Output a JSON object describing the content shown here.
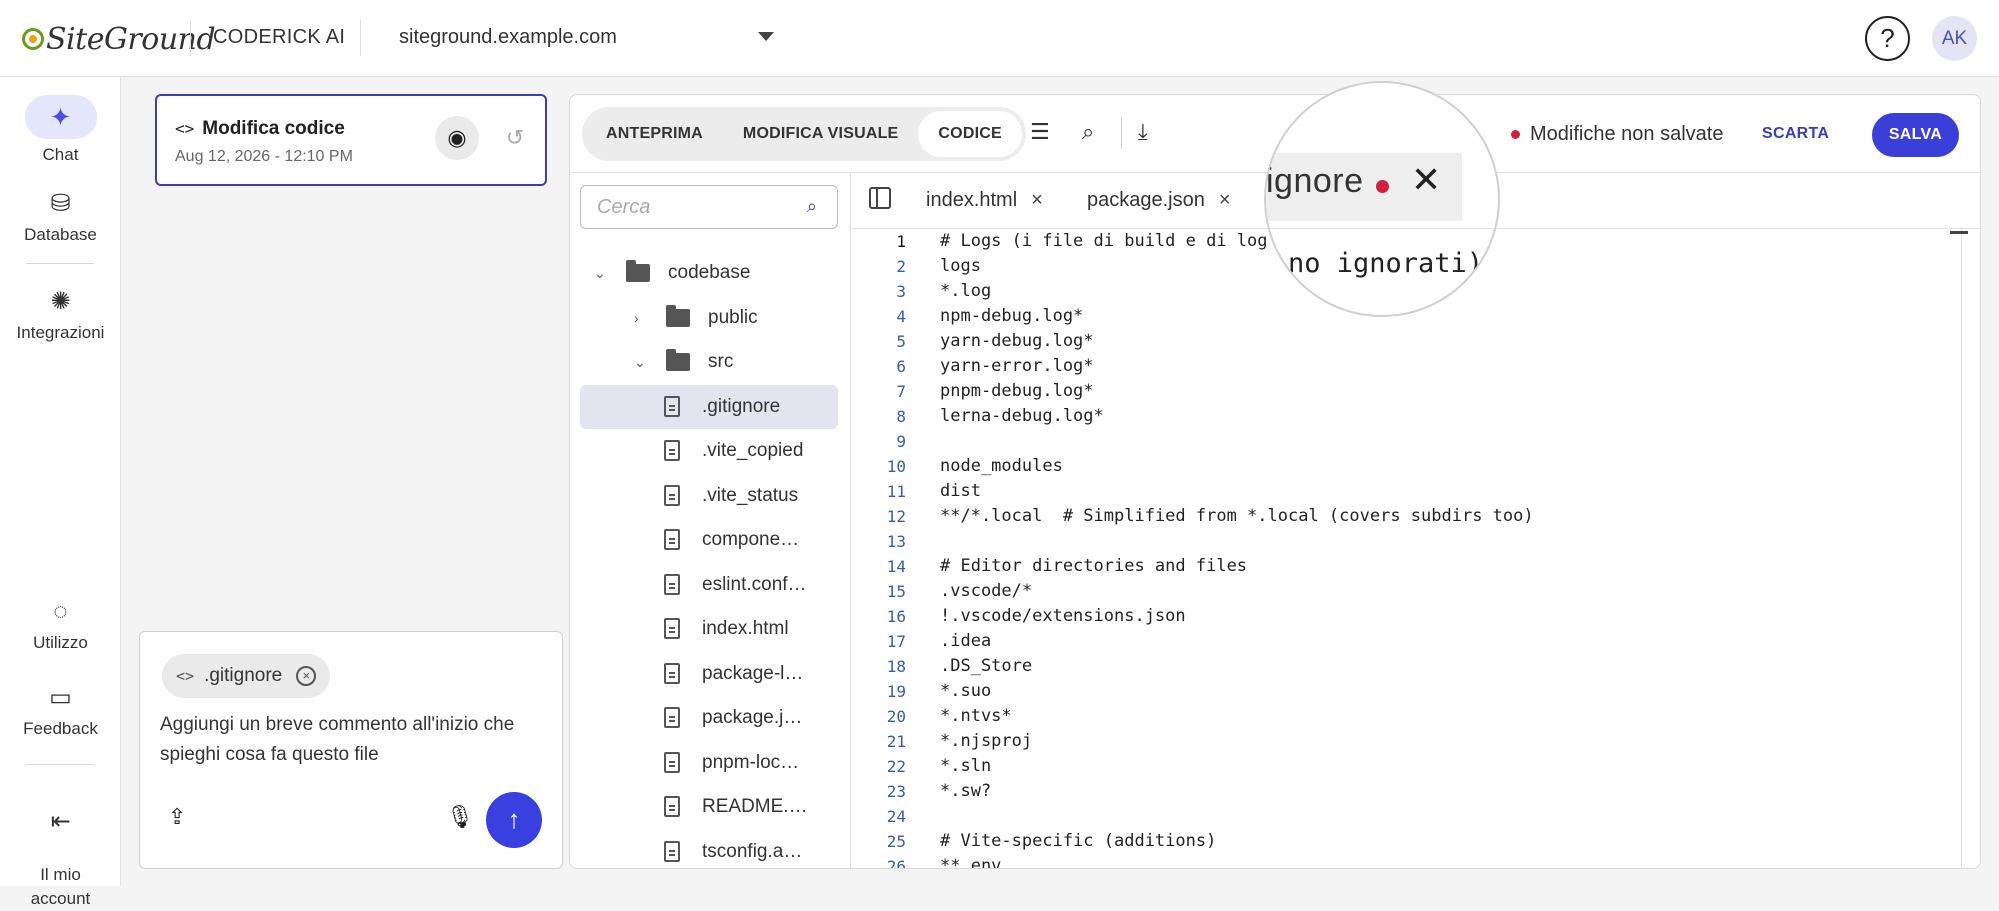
{
  "header": {
    "logo_text": "SiteGround",
    "product_name": "CODERICK AI",
    "domain": "siteground.example.com",
    "help_label": "?",
    "avatar_initials": "AK"
  },
  "sidenav": {
    "items": [
      {
        "label": "Chat",
        "icon": "sparkle-icon"
      },
      {
        "label": "Database",
        "icon": "database-icon"
      },
      {
        "label": "Integrazioni",
        "icon": "integrations-icon"
      },
      {
        "label": "Utilizzo",
        "icon": "usage-icon"
      },
      {
        "label": "Feedback",
        "icon": "feedback-icon"
      },
      {
        "label": "Il mio\naccount",
        "icon": "account-icon"
      }
    ]
  },
  "task": {
    "title": "Modifica codice",
    "date": "Aug 12, 2026 - 12:10 PM"
  },
  "composer": {
    "chip_label": ".gitignore",
    "prompt_text": "Aggiungi un breve commento all'inizio che spieghi cosa fa questo file"
  },
  "editor": {
    "tabs": [
      "ANTEPRIMA",
      "MODIFICA VISUALE",
      "CODICE"
    ],
    "active_tab": "CODICE",
    "unsaved_text": "Modifiche non salvate",
    "discard_label": "SCARTA",
    "save_label": "SALVA",
    "search_placeholder": "Cerca",
    "tree": [
      {
        "type": "folder",
        "label": "codebase",
        "expanded": true,
        "depth": 0
      },
      {
        "type": "folder",
        "label": "public",
        "expanded": false,
        "depth": 1
      },
      {
        "type": "folder",
        "label": "src",
        "expanded": true,
        "depth": 1
      },
      {
        "type": "file",
        "label": ".gitignore",
        "depth": 2,
        "selected": true
      },
      {
        "type": "file",
        "label": ".vite_copied",
        "depth": 2
      },
      {
        "type": "file",
        "label": ".vite_status",
        "depth": 2
      },
      {
        "type": "file",
        "label": "compone…",
        "depth": 2
      },
      {
        "type": "file",
        "label": "eslint.conf…",
        "depth": 2
      },
      {
        "type": "file",
        "label": "index.html",
        "depth": 2
      },
      {
        "type": "file",
        "label": "package-l…",
        "depth": 2
      },
      {
        "type": "file",
        "label": "package.j…",
        "depth": 2
      },
      {
        "type": "file",
        "label": "pnpm-loc…",
        "depth": 2
      },
      {
        "type": "file",
        "label": "README.…",
        "depth": 2
      },
      {
        "type": "file",
        "label": "tsconfig.a…",
        "depth": 2
      }
    ],
    "open_files": [
      {
        "label": "index.html",
        "close": "×"
      },
      {
        "label": "package.json",
        "close": "×"
      }
    ],
    "magnified_tab": "ignore",
    "magnified_code": "no ignorati)",
    "code_lines": [
      "# Logs (i file di build e di log",
      "logs",
      "*.log",
      "npm-debug.log*",
      "yarn-debug.log*",
      "yarn-error.log*",
      "pnpm-debug.log*",
      "lerna-debug.log*",
      "",
      "node_modules",
      "dist",
      "**/*.local  # Simplified from *.local (covers subdirs too)",
      "",
      "# Editor directories and files",
      ".vscode/*",
      "!.vscode/extensions.json",
      ".idea",
      ".DS_Store",
      "*.suo",
      "*.ntvs*",
      "*.njsproj",
      "*.sln",
      "*.sw?",
      "",
      "# Vite-specific (additions)",
      "**.env"
    ]
  }
}
